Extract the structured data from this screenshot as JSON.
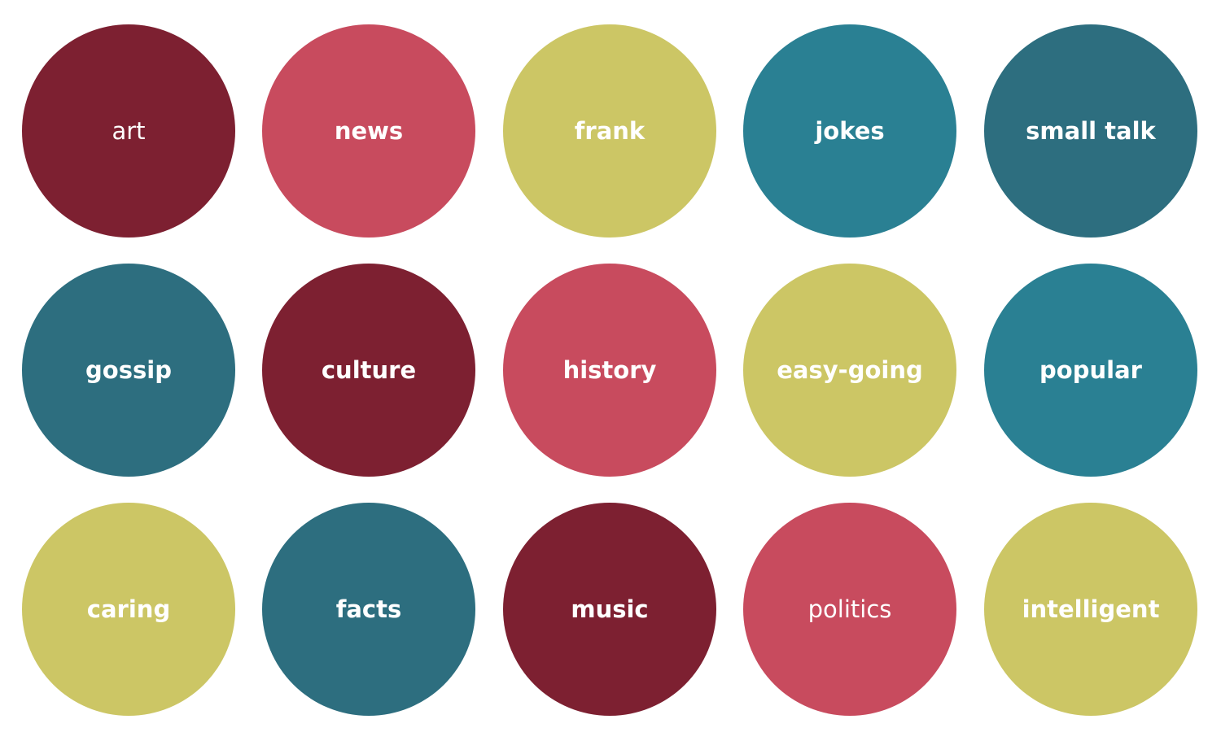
{
  "palette": {
    "maroon": "#7D2031",
    "rose": "#C84B5E",
    "olive": "#CCC665",
    "teal": "#2A8093",
    "slate": "#2D6E7F"
  },
  "bubbles": [
    {
      "label": "art",
      "color": "#7D2031"
    },
    {
      "label": "news",
      "color": "#C84B5E"
    },
    {
      "label": "frank",
      "color": "#CCC665"
    },
    {
      "label": "jokes",
      "color": "#2A8093"
    },
    {
      "label": "small talk",
      "color": "#2D6E7F"
    },
    {
      "label": "gossip",
      "color": "#2D6E7F"
    },
    {
      "label": "culture",
      "color": "#7D2031"
    },
    {
      "label": "history",
      "color": "#C84B5E"
    },
    {
      "label": "easy-going",
      "color": "#CCC665"
    },
    {
      "label": "popular",
      "color": "#2A8093"
    },
    {
      "label": "caring",
      "color": "#CCC665"
    },
    {
      "label": "facts",
      "color": "#2D6E7F"
    },
    {
      "label": "music",
      "color": "#7D2031"
    },
    {
      "label": "politics",
      "color": "#C84B5E"
    },
    {
      "label": "intelligent",
      "color": "#CCC665"
    }
  ]
}
